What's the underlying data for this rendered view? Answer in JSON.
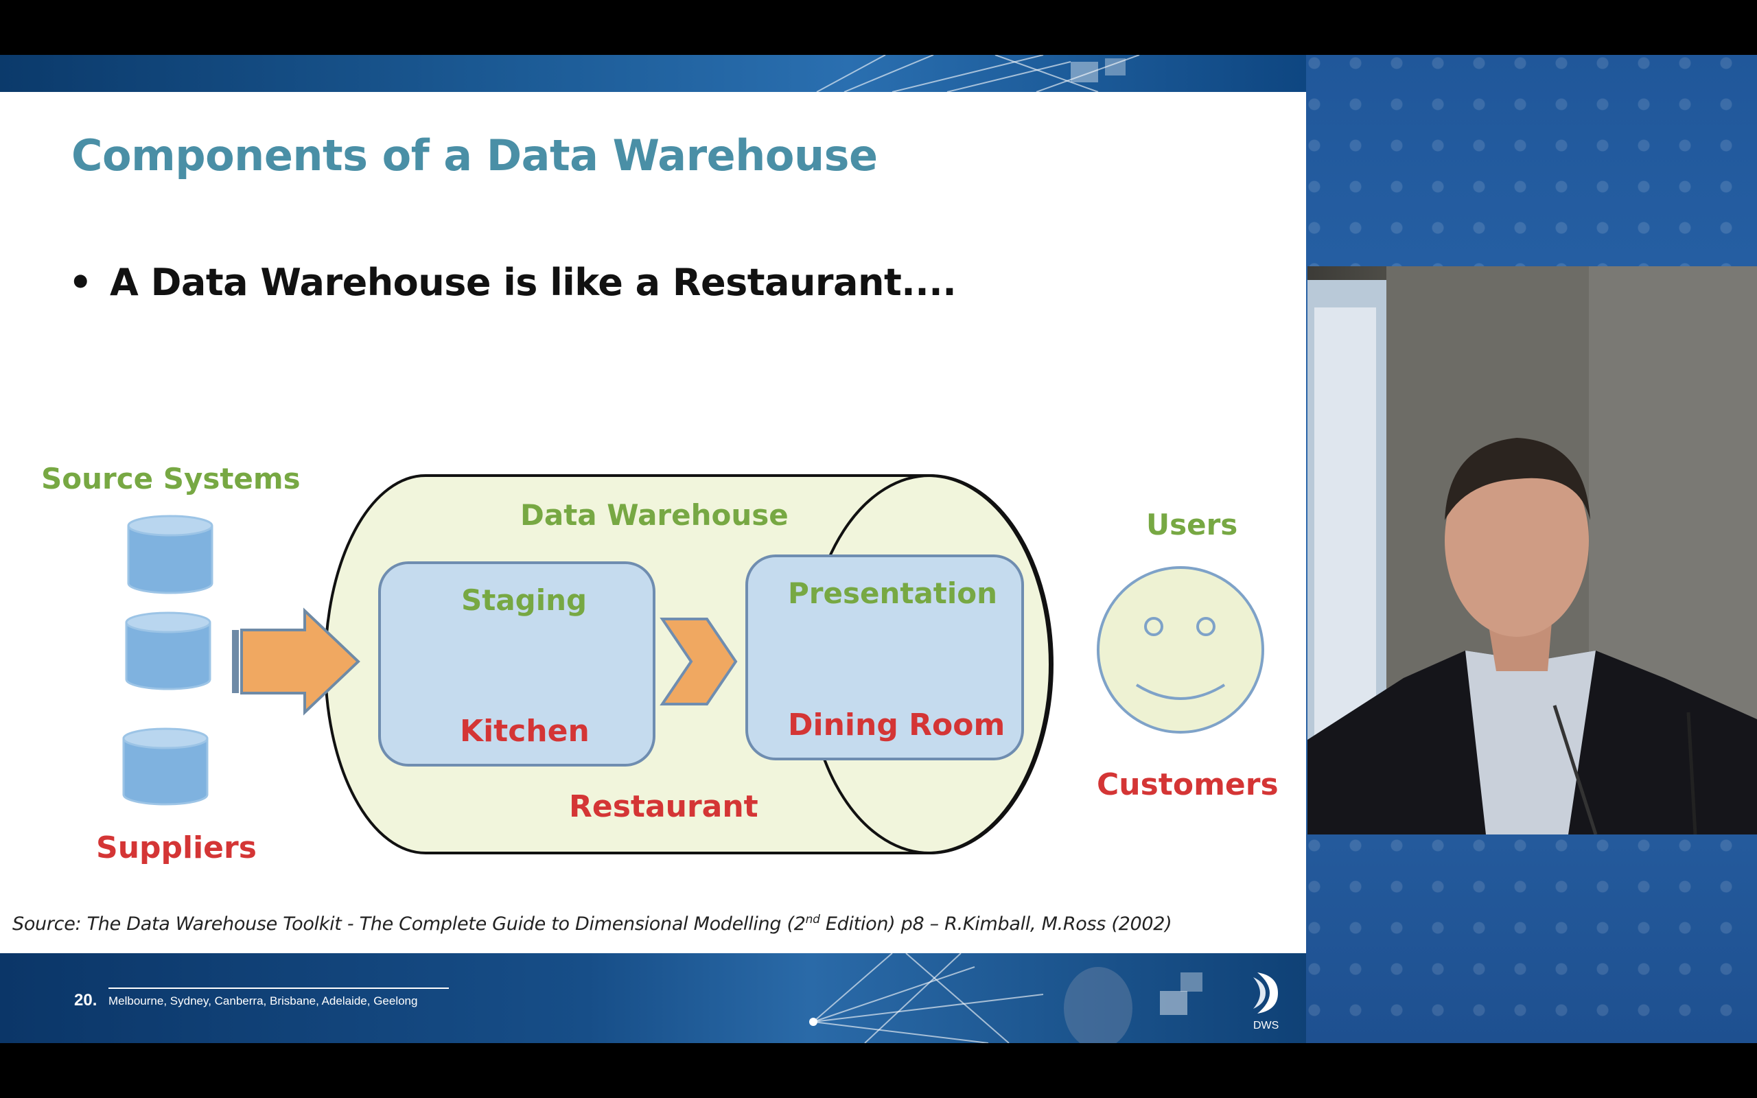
{
  "slide": {
    "title": "Components of a Data Warehouse",
    "bullet": "A Data Warehouse is like a Restaurant....",
    "bullet_marker": "•",
    "diagram": {
      "source_systems": "Source Systems",
      "suppliers": "Suppliers",
      "data_warehouse": "Data Warehouse",
      "staging": "Staging",
      "kitchen": "Kitchen",
      "presentation": "Presentation",
      "dining_room": "Dining Room",
      "restaurant": "Restaurant",
      "users": "Users",
      "customers": "Customers"
    },
    "source_prefix": "Source: The Data Warehouse Toolkit  - The Complete Guide to Dimensional Modelling (2",
    "source_sup": "nd",
    "source_suffix": " Edition) p8 – R.Kimball, M.Ross (2002)",
    "page_number": "20.",
    "footer_cities": "Melbourne, Sydney, Canberra, Brisbane, Adelaide, Geelong",
    "logo_text": "DWS"
  },
  "colors": {
    "title": "#4a8fa6",
    "green_label": "#77a843",
    "red_label": "#d43535",
    "cylinder_fill": "#f1f5dc",
    "box_fill": "#c5dbee",
    "arrow": "#f0a861"
  }
}
